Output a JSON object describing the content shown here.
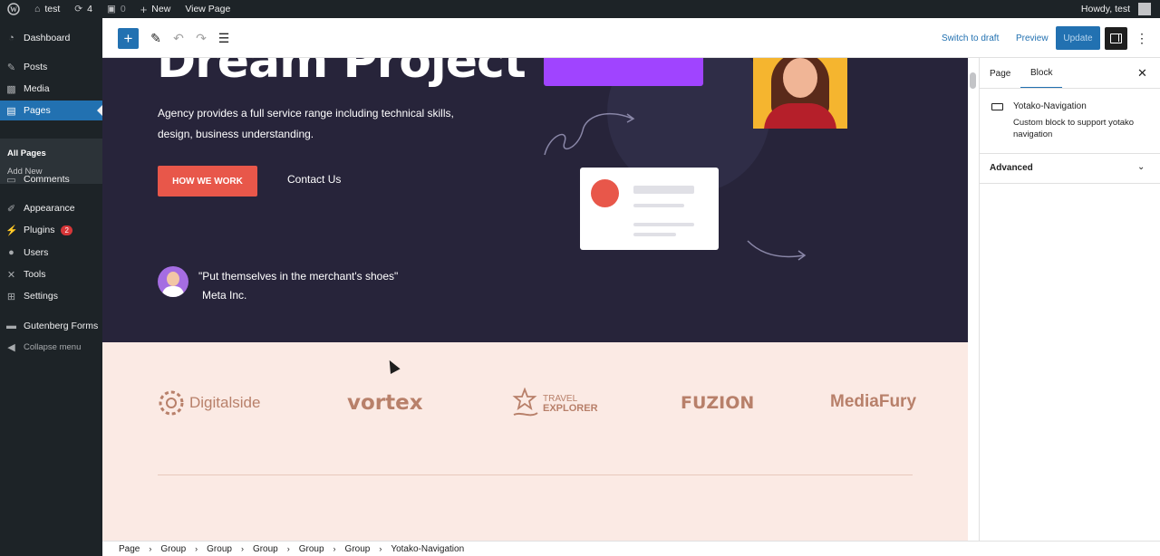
{
  "adminbar": {
    "site_name": "test",
    "updates_count": "4",
    "comments_count": "0",
    "new_label": "New",
    "view_page": "View Page",
    "howdy": "Howdy, test"
  },
  "sidebar": {
    "items": [
      {
        "label": "Dashboard",
        "icon": "dashboard-icon"
      },
      {
        "label": "Posts",
        "icon": "pin-icon"
      },
      {
        "label": "Media",
        "icon": "media-icon"
      },
      {
        "label": "Pages",
        "icon": "pages-icon"
      },
      {
        "label": "Comments",
        "icon": "comments-icon"
      },
      {
        "label": "Appearance",
        "icon": "brush-icon"
      },
      {
        "label": "Plugins",
        "icon": "plugin-icon",
        "badge": "2"
      },
      {
        "label": "Users",
        "icon": "users-icon"
      },
      {
        "label": "Tools",
        "icon": "wrench-icon"
      },
      {
        "label": "Settings",
        "icon": "settings-icon"
      },
      {
        "label": "Gutenberg Forms",
        "icon": "forms-icon"
      }
    ],
    "submenu": [
      "All Pages",
      "Add New"
    ],
    "collapse": "Collapse menu"
  },
  "header": {
    "switch_to_draft": "Switch to draft",
    "preview": "Preview",
    "update": "Update"
  },
  "hero": {
    "title": "Dream Project",
    "description": "Agency provides a full service range including technical skills, design, business understanding.",
    "primary_button": "HOW WE WORK",
    "secondary_link": "Contact Us",
    "quote": "\"Put themselves in the merchant's shoes\"",
    "company": "Meta Inc."
  },
  "logos": [
    "Digitalside",
    "vortex",
    "TRAVEL",
    "EXPLORER",
    "FUZION",
    "MediaFury"
  ],
  "settings_panel": {
    "tabs": [
      "Page",
      "Block"
    ],
    "active_tab": "Block",
    "block_name": "Yotako-Navigation",
    "block_description": "Custom block to support yotako navigation",
    "advanced": "Advanced"
  },
  "breadcrumb": [
    "Page",
    "Group",
    "Group",
    "Group",
    "Group",
    "Group",
    "Yotako-Navigation"
  ],
  "colors": {
    "admin_dark": "#1d2327",
    "accent_blue": "#2271b1",
    "hero_bg": "#27243a",
    "cta_red": "#e8574a",
    "logos_bg": "#fbeae4",
    "purple": "#a044ff"
  }
}
